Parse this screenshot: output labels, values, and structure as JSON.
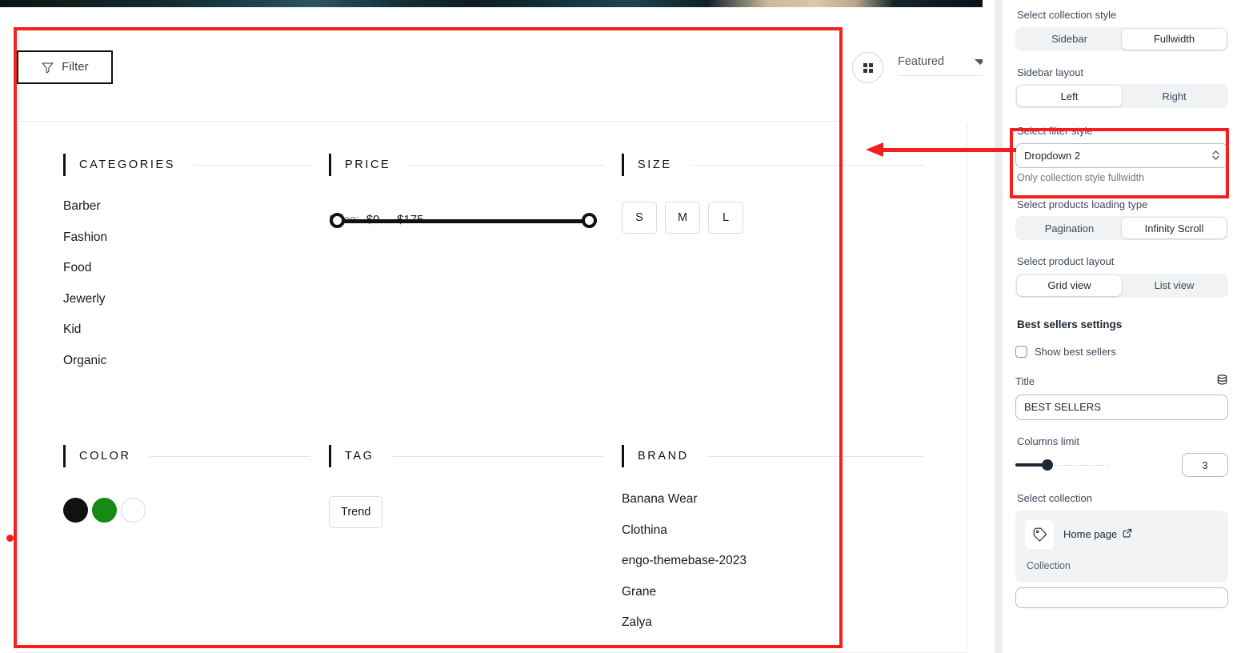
{
  "preview": {
    "toolbar": {
      "filter_button_label": "Filter",
      "filter_icon": "funnel-icon",
      "grid_view_icon": "grid-view-icon",
      "sort_label": "Featured",
      "sort_caret_icon": "caret-down-icon"
    },
    "filters": {
      "categories": {
        "title": "CATEGORIES",
        "items": [
          "Barber",
          "Fashion",
          "Food",
          "Jewerly",
          "Kid",
          "Organic"
        ]
      },
      "price": {
        "title": "PRICE",
        "label": "Price:",
        "min_value": "$0",
        "separator": "-",
        "max_value": "$175"
      },
      "size": {
        "title": "SIZE",
        "options": [
          "S",
          "M",
          "L"
        ]
      },
      "color": {
        "title": "COLOR",
        "swatches": [
          {
            "name": "black",
            "hex": "#111111"
          },
          {
            "name": "green",
            "hex": "#158b16"
          },
          {
            "name": "white",
            "hex": "#ffffff"
          }
        ]
      },
      "tag": {
        "title": "TAG",
        "options": [
          "Trend"
        ]
      },
      "brand": {
        "title": "BRAND",
        "items": [
          "Banana Wear",
          "Clothina",
          "engo-themebase-2023",
          "Grane",
          "Zalya"
        ]
      }
    }
  },
  "settings": {
    "collection_style": {
      "label": "Select collection style",
      "options": [
        "Sidebar",
        "Fullwidth"
      ],
      "selected": "Fullwidth"
    },
    "sidebar_layout": {
      "label": "Sidebar layout",
      "options": [
        "Left",
        "Right"
      ],
      "selected": "Left"
    },
    "filter_style": {
      "label": "Select filter style",
      "value": "Dropdown 2",
      "help": "Only collection style fullwidth",
      "chevron_icon": "select-chevron-icon"
    },
    "loading_type": {
      "label": "Select products loading type",
      "options": [
        "Pagination",
        "Infinity Scroll"
      ],
      "selected": "Infinity Scroll"
    },
    "product_layout": {
      "label": "Select product layout",
      "options": [
        "Grid view",
        "List view"
      ],
      "selected": "Grid view"
    },
    "best_sellers": {
      "heading": "Best sellers settings",
      "show_label": "Show best sellers",
      "show_checked": false,
      "title_label": "Title",
      "title_dynamic_source_icon": "database-icon",
      "title_value": "BEST SELLERS",
      "columns_limit_label": "Columns limit",
      "columns_limit_value": "3"
    },
    "select_collection": {
      "label": "Select collection",
      "item_name": "Home page",
      "item_type": "Collection",
      "thumb_icon": "collection-tag-icon",
      "external_link_icon": "external-link-icon"
    }
  },
  "annotations": {
    "accent_color": "#f41f1f",
    "arrow_icon": "left-arrow-annotation"
  }
}
